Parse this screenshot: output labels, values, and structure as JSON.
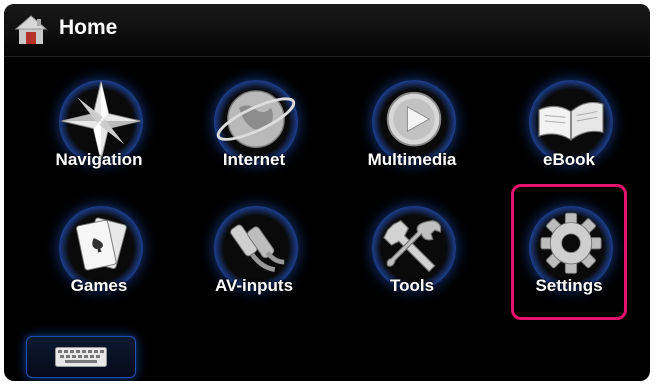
{
  "header": {
    "title": "Home",
    "icon": "home-icon"
  },
  "tiles": [
    {
      "label": "Navigation",
      "icon": "compass-icon"
    },
    {
      "label": "Internet",
      "icon": "globe-icon"
    },
    {
      "label": "Multimedia",
      "icon": "play-icon"
    },
    {
      "label": "eBook",
      "icon": "book-icon"
    },
    {
      "label": "Games",
      "icon": "playing-cards-icon"
    },
    {
      "label": "AV-inputs",
      "icon": "av-cables-icon"
    },
    {
      "label": "Tools",
      "icon": "tools-icon"
    },
    {
      "label": "Settings",
      "icon": "gear-icon"
    }
  ],
  "footer": {
    "keyboard_icon": "keyboard-icon"
  },
  "colors": {
    "accent_glow": "#2a6eff",
    "highlight": "#e8126e",
    "background": "#000000"
  }
}
